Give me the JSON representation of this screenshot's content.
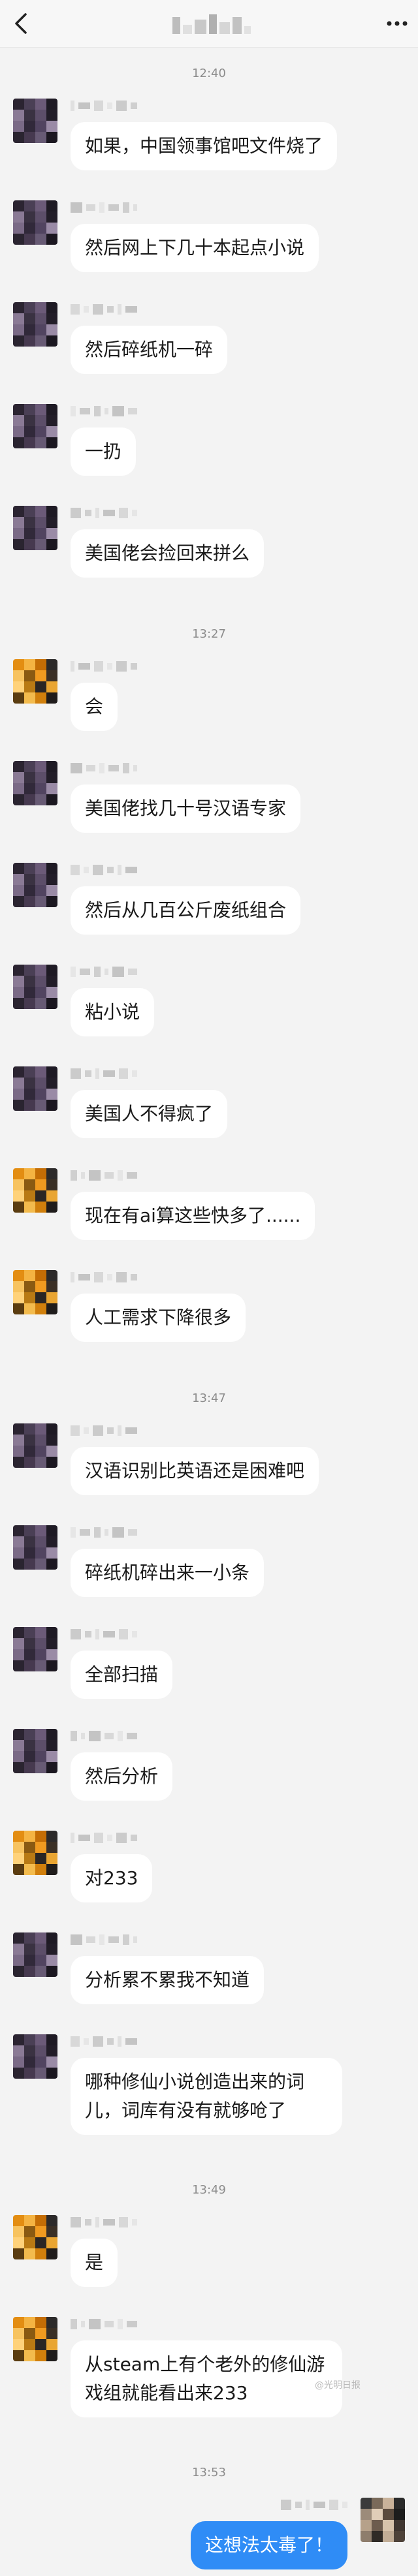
{
  "header": {
    "back_icon": "chevron-left-icon",
    "more_icon": "ellipsis-icon"
  },
  "colors": {
    "background": "#f3f3f3",
    "incoming_bubble": "#ffffff",
    "outgoing_bubble": "#2f8cf6",
    "timestamp": "#8c8c8c"
  },
  "feed": [
    {
      "kind": "time",
      "text": "12:40"
    },
    {
      "kind": "in",
      "avatar": "dark",
      "text": "如果，中国领事馆吧文件烧了"
    },
    {
      "kind": "in",
      "avatar": "dark",
      "text": "然后网上下几十本起点小说"
    },
    {
      "kind": "in",
      "avatar": "dark",
      "text": "然后碎纸机一碎"
    },
    {
      "kind": "in",
      "avatar": "dark",
      "text": "一扔"
    },
    {
      "kind": "in",
      "avatar": "dark",
      "text": "美国佬会捡回来拼么"
    },
    {
      "kind": "time",
      "text": "13:27"
    },
    {
      "kind": "in",
      "avatar": "orange",
      "text": "会"
    },
    {
      "kind": "in",
      "avatar": "dark",
      "text": "美国佬找几十号汉语专家"
    },
    {
      "kind": "in",
      "avatar": "dark",
      "text": "然后从几百公斤废纸组合"
    },
    {
      "kind": "in",
      "avatar": "dark",
      "text": "粘小说"
    },
    {
      "kind": "in",
      "avatar": "dark",
      "text": "美国人不得疯了"
    },
    {
      "kind": "in",
      "avatar": "orange",
      "text": "现在有ai算这些快多了......"
    },
    {
      "kind": "in",
      "avatar": "orange",
      "text": "人工需求下降很多"
    },
    {
      "kind": "time",
      "text": "13:47"
    },
    {
      "kind": "in",
      "avatar": "dark",
      "text": "汉语识别比英语还是困难吧"
    },
    {
      "kind": "in",
      "avatar": "dark",
      "text": "碎纸机碎出来一小条"
    },
    {
      "kind": "in",
      "avatar": "dark",
      "text": "全部扫描"
    },
    {
      "kind": "in",
      "avatar": "dark",
      "text": "然后分析"
    },
    {
      "kind": "in",
      "avatar": "orange",
      "text": "对233"
    },
    {
      "kind": "in",
      "avatar": "dark",
      "text": "分析累不累我不知道"
    },
    {
      "kind": "in",
      "avatar": "dark",
      "text": "哪种修仙小说创造出来的词儿，词库有没有就够呛了",
      "wide": true
    },
    {
      "kind": "time",
      "text": "13:49"
    },
    {
      "kind": "in",
      "avatar": "orange",
      "text": "是"
    },
    {
      "kind": "in",
      "avatar": "orange",
      "text": "从steam上有个老外的修仙游戏组就能看出来233",
      "wide": true
    },
    {
      "kind": "time",
      "text": "13:53"
    },
    {
      "kind": "out",
      "avatar": "self",
      "text": "这想法太毒了！"
    }
  ],
  "watermark": "@光明日报"
}
